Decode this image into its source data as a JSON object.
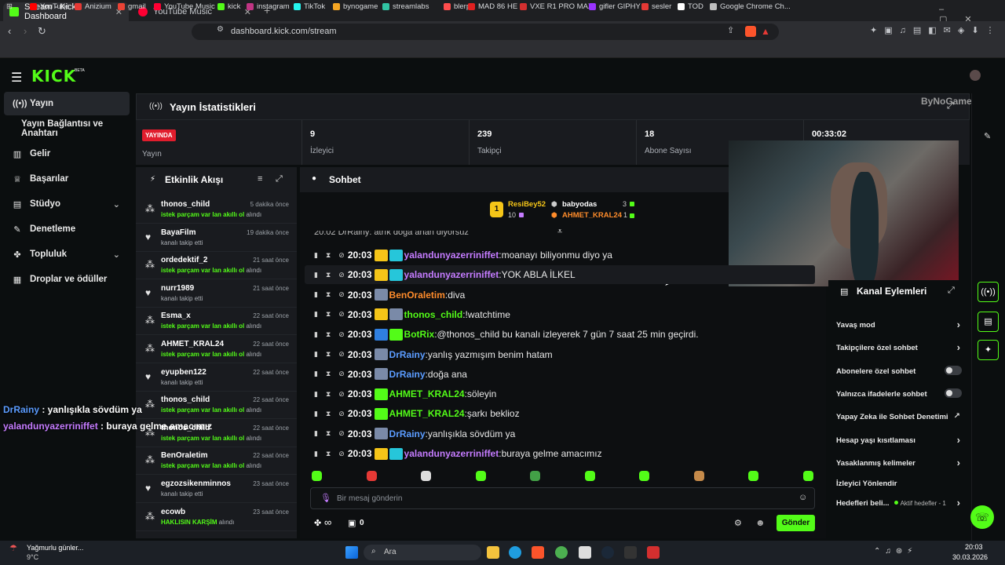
{
  "browser": {
    "tabs": [
      {
        "label": "Stream - Kick Dashboard",
        "color": "#53fc18"
      },
      {
        "label": "YouTube Music",
        "color": "#ff0033"
      }
    ],
    "url": "dashboard.kick.com/stream",
    "bookmarks": [
      {
        "label": "YouTube",
        "color": "#ff0000"
      },
      {
        "label": "Anizium",
        "color": "#e53935"
      },
      {
        "label": "gmail",
        "color": "#ea4335"
      },
      {
        "label": "YouTube Music",
        "color": "#ff0033"
      },
      {
        "label": "kick",
        "color": "#53fc18"
      },
      {
        "label": "instagram",
        "color": "#c13584"
      },
      {
        "label": "TikTok",
        "color": "#25f4ee"
      },
      {
        "label": "bynogame",
        "color": "#f5a623"
      },
      {
        "label": "streamlabs",
        "color": "#31c3a2"
      },
      {
        "label": "blerp",
        "color": "#ff4d4d"
      },
      {
        "label": "MAD 86 HE",
        "color": "#e02020"
      },
      {
        "label": "VXE R1 PRO MAX",
        "color": "#d32f2f"
      },
      {
        "label": "gifler GIPHY",
        "color": "#9933ff"
      },
      {
        "label": "sesler",
        "color": "#e53935"
      },
      {
        "label": "TOD",
        "color": "#ffffff"
      },
      {
        "label": "Google Chrome Ch...",
        "color": "#bdbdbd"
      }
    ]
  },
  "brand": {
    "logo": "KICK",
    "beta": "BETA",
    "accent": "#53fc18"
  },
  "sidebar": [
    {
      "label": "Yayın",
      "icon": "broadcast-icon",
      "active": true
    },
    {
      "label": "Yayın Bağlantısı ve Anahtarı",
      "icon": "",
      "active": false
    },
    {
      "label": "Gelir",
      "icon": "chart-icon"
    },
    {
      "label": "Başarılar",
      "icon": "trophy-icon"
    },
    {
      "label": "Stüdyo",
      "icon": "studio-icon",
      "chevron": "⌄"
    },
    {
      "label": "Denetleme",
      "icon": "wrench-icon"
    },
    {
      "label": "Topluluk",
      "icon": "people-icon",
      "chevron": "⌄"
    },
    {
      "label": "Droplar ve ödüller",
      "icon": "gift-icon"
    }
  ],
  "stats": {
    "title": "Yayın İstatistikleri",
    "live_badge": "YAYINDA",
    "live_label": "Yayın",
    "items": [
      {
        "value": "9",
        "label": "İzleyici"
      },
      {
        "value": "239",
        "label": "Takipçi"
      },
      {
        "value": "18",
        "label": "Abone Sayısı"
      },
      {
        "value": "00:33:02",
        "label": ""
      }
    ]
  },
  "activity": {
    "title": "Etkinlik Akışı",
    "items": [
      {
        "name": "thonos_child",
        "time": "5 dakika önce",
        "desc": "istek parçam var lan akıllı ol",
        "suffix": " alındı",
        "type": "reward"
      },
      {
        "name": "BayaFilm",
        "time": "19 dakika önce",
        "desc": "",
        "suffix": "kanalı takip etti",
        "type": "follow"
      },
      {
        "name": "ordedektif_2",
        "time": "21 saat önce",
        "desc": "istek parçam var lan akıllı ol",
        "suffix": " alındı",
        "type": "reward"
      },
      {
        "name": "nurr1989",
        "time": "21 saat önce",
        "desc": "",
        "suffix": "kanalı takip etti",
        "type": "follow"
      },
      {
        "name": "Esma_x",
        "time": "22 saat önce",
        "desc": "istek parçam var lan akıllı ol",
        "suffix": " alındı",
        "type": "reward"
      },
      {
        "name": "AHMET_KRAL24",
        "time": "22 saat önce",
        "desc": "istek parçam var lan akıllı ol",
        "suffix": " alındı",
        "type": "reward"
      },
      {
        "name": "eyupben122",
        "time": "22 saat önce",
        "desc": "",
        "suffix": "kanalı takip etti",
        "type": "follow"
      },
      {
        "name": "thonos_child",
        "time": "22 saat önce",
        "desc": "istek parçam var lan akıllı ol",
        "suffix": " alındı",
        "type": "reward"
      },
      {
        "name": "thonos_child",
        "time": "22 saat önce",
        "desc": "istek parçam var lan akıllı ol",
        "suffix": " alındı",
        "type": "reward"
      },
      {
        "name": "BenOraletim",
        "time": "22 saat önce",
        "desc": "istek parçam var lan akıllı ol",
        "suffix": " alındı",
        "type": "reward"
      },
      {
        "name": "egzozsikenminnos",
        "time": "23 saat önce",
        "desc": "",
        "suffix": "kanalı takip etti",
        "type": "follow"
      },
      {
        "name": "ecowb",
        "time": "23 saat önce",
        "desc": "HAKLISIN KARŞİM",
        "suffix": " alındı",
        "type": "reward"
      }
    ]
  },
  "chat": {
    "title": "Sohbet",
    "top": [
      {
        "rank": "1",
        "name": "ResiBey52",
        "count": "10"
      },
      {
        "name": "babyodas",
        "count": "3"
      },
      {
        "name": "AHMET_KRAL24",
        "count": "1"
      }
    ],
    "messages": [
      {
        "time": "20:03",
        "user": "yalandunyazerriniffet",
        "color": "#c57cff",
        "text": "moanayı biliyonmu diyo ya",
        "badges": [
          "#f5c518",
          "#26c6da"
        ]
      },
      {
        "time": "20:03",
        "user": "yalandunyazerriniffet",
        "color": "#c57cff",
        "text": "YOK ABLA İLKEL",
        "badges": [
          "#f5c518",
          "#26c6da"
        ],
        "hl": true
      },
      {
        "time": "20:03",
        "user": "BenOraletim",
        "color": "#ff8c2b",
        "text": "diva",
        "badges": [
          "#7a8aa8"
        ]
      },
      {
        "time": "20:03",
        "user": "thonos_child",
        "color": "#53fc18",
        "text": "!watchtime",
        "badges": [
          "#f5c518",
          "#7a8aa8"
        ]
      },
      {
        "time": "20:03",
        "user": "BotRix",
        "color": "#53fc18",
        "text": "@thonos_child bu kanalı izleyerek 7 gün 7 saat 25 min geçirdi.",
        "badges": [
          "#2f7fe0",
          "#53fc18"
        ]
      },
      {
        "time": "20:03",
        "user": "DrRainy",
        "color": "#5b9cff",
        "text": "yanlış yazmışım benim hatam",
        "badges": [
          "#7a8aa8"
        ]
      },
      {
        "time": "20:03",
        "user": "DrRainy",
        "color": "#5b9cff",
        "text": "doğa ana",
        "badges": [
          "#7a8aa8"
        ]
      },
      {
        "time": "20:03",
        "user": "AHMET_KRAL24",
        "color": "#53fc18",
        "text": "söleyin",
        "badges": [
          "#53fc18"
        ]
      },
      {
        "time": "20:03",
        "user": "AHMET_KRAL24",
        "color": "#53fc18",
        "text": "şarkı beklioz",
        "badges": [
          "#53fc18"
        ]
      },
      {
        "time": "20:03",
        "user": "DrRainy",
        "color": "#5b9cff",
        "text": "yanlışıkla sövdüm ya",
        "badges": [
          "#7a8aa8"
        ]
      },
      {
        "time": "20:03",
        "user": "yalandunyazerriniffet",
        "color": "#c57cff",
        "text": "buraya gelme amacımız",
        "badges": [
          "#f5c518",
          "#26c6da"
        ]
      }
    ],
    "partial_top": "20:02  DrRainy: atrık doğa anan diyorsuz",
    "input_placeholder": "Bir mesaj gönderin",
    "send_label": "Gönder",
    "footer_count": "0",
    "infinity": "∞"
  },
  "channel_actions": {
    "title": "Kanal Eylemleri",
    "items": [
      {
        "label": "Yavaş mod",
        "control": "chevron"
      },
      {
        "label": "Takipçilere özel sohbet",
        "control": "chevron"
      },
      {
        "label": "Abonelere özel sohbet",
        "control": "toggle"
      },
      {
        "label": "Yalnızca ifadelerle sohbet",
        "control": "toggle"
      },
      {
        "label": "Yapay Zeka ile Sohbet Denetimi",
        "control": "external"
      },
      {
        "label": "Hesap yaşı kısıtlaması",
        "control": "chevron"
      },
      {
        "label": "Yasaklanmış kelimeler",
        "control": "chevron"
      },
      {
        "label": "İzleyici Yönlendir",
        "control": "none"
      },
      {
        "label": "Hedefleri beli...",
        "control": "chevron",
        "note": "Aktif hedefler - 1"
      }
    ]
  },
  "overlay": [
    {
      "user": "DrRainy",
      "text": " : yanlışıkla sövdüm ya",
      "color": "#5b9cff"
    },
    {
      "user": "yalandunyazerriniffet",
      "text": " : buraya gelme amacımız",
      "color": "#c57cff"
    }
  ],
  "watermark": "ByNoGame",
  "taskbar": {
    "weather_title": "Yağmurlu günler...",
    "weather_temp": "9°C",
    "search": "Ara",
    "time": "20:03",
    "date": "30.03.2026"
  }
}
